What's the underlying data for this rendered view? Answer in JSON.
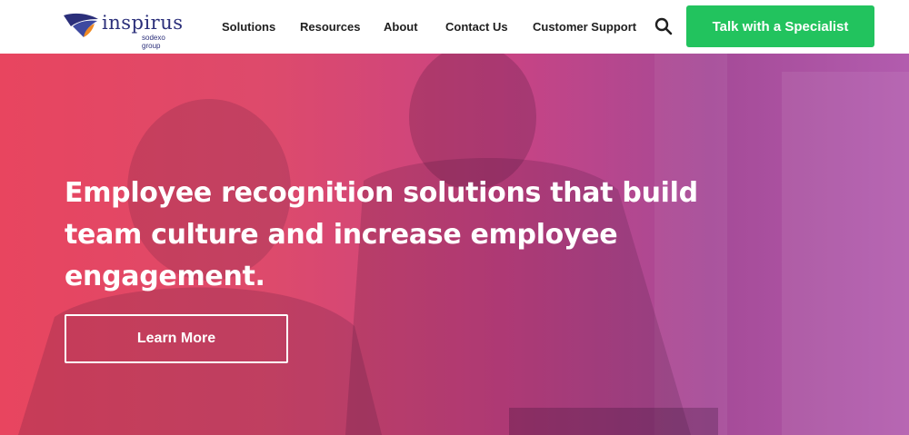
{
  "brand": {
    "name": "inspirus",
    "tagline": "sodexo group",
    "colors": {
      "navy": "#2b2f7a",
      "orange": "#f08a24",
      "green": "#22c35e"
    }
  },
  "nav": {
    "items": [
      {
        "label": "Solutions"
      },
      {
        "label": "Resources"
      },
      {
        "label": "About"
      },
      {
        "label": "Contact Us"
      },
      {
        "label": "Customer Support"
      }
    ],
    "search_icon": "search-icon",
    "cta_label": "Talk with a Specialist"
  },
  "hero": {
    "title": "Employee recognition solutions that build team culture and increase employee engagement.",
    "button_label": "Learn More",
    "overlay_colors": [
      "#e8455f",
      "#c94383",
      "#a54a97"
    ]
  }
}
